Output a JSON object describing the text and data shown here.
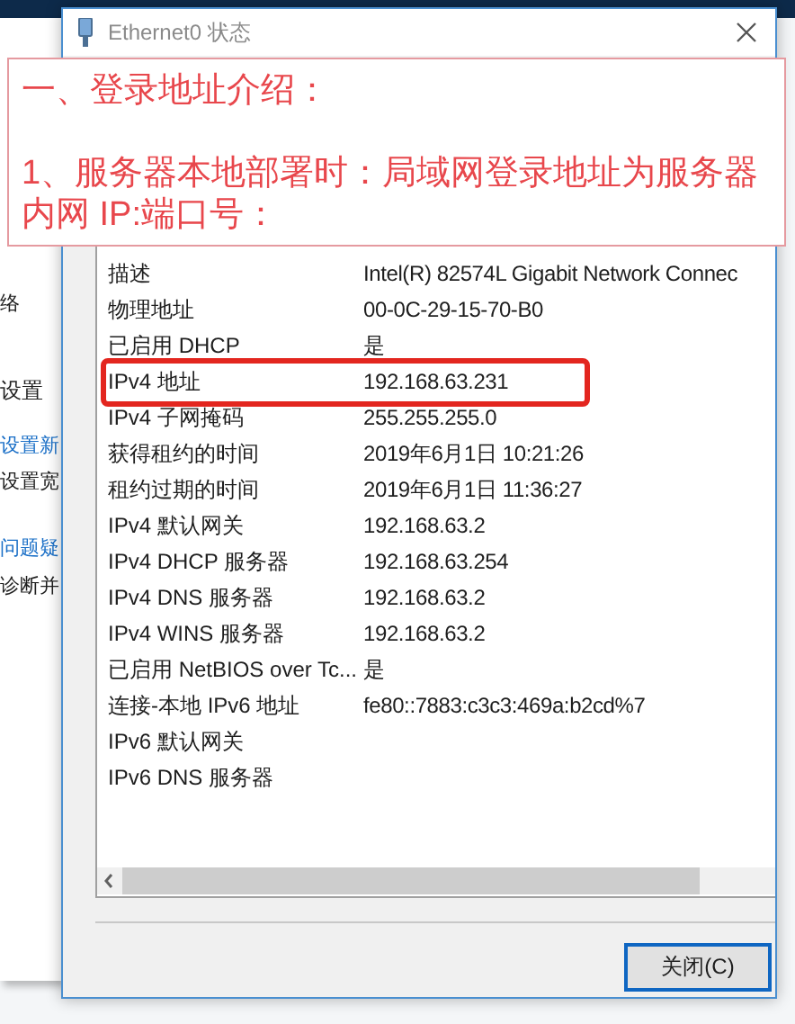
{
  "background_window": {
    "texts": [
      {
        "text": "络",
        "kind": "plain"
      },
      {
        "text": "设置",
        "kind": "heading"
      },
      {
        "text": "设置新",
        "kind": "link"
      },
      {
        "text": "设置宽",
        "kind": "plain"
      },
      {
        "text": "问题疑",
        "kind": "link"
      },
      {
        "text": "诊断并",
        "kind": "plain"
      }
    ]
  },
  "dialog": {
    "title": "Ethernet0 状态",
    "details": [
      {
        "label": "描述",
        "value": "Intel(R) 82574L Gigabit Network Connec",
        "highlighted": false
      },
      {
        "label": "物理地址",
        "value": "00-0C-29-15-70-B0",
        "highlighted": false
      },
      {
        "label": "已启用 DHCP",
        "value": "是",
        "highlighted": false
      },
      {
        "label": "IPv4 地址",
        "value": "192.168.63.231",
        "highlighted": true
      },
      {
        "label": "IPv4 子网掩码",
        "value": "255.255.255.0",
        "highlighted": false
      },
      {
        "label": "获得租约的时间",
        "value": "2019年6月1日 10:21:26",
        "highlighted": false
      },
      {
        "label": "租约过期的时间",
        "value": "2019年6月1日 11:36:27",
        "highlighted": false
      },
      {
        "label": "IPv4 默认网关",
        "value": "192.168.63.2",
        "highlighted": false
      },
      {
        "label": "IPv4 DHCP 服务器",
        "value": "192.168.63.254",
        "highlighted": false
      },
      {
        "label": "IPv4 DNS 服务器",
        "value": "192.168.63.2",
        "highlighted": false
      },
      {
        "label": "IPv4 WINS 服务器",
        "value": "192.168.63.2",
        "highlighted": false
      },
      {
        "label": "已启用 NetBIOS over Tc...",
        "value": "是",
        "highlighted": false
      },
      {
        "label": "连接-本地 IPv6 地址",
        "value": "fe80::7883:c3c3:469a:b2cd%7",
        "highlighted": false
      },
      {
        "label": "IPv6 默认网关",
        "highlighted": false
      },
      {
        "label": "IPv6 DNS 服务器",
        "highlighted": false
      }
    ],
    "close_button": "关闭(C)"
  },
  "annotation": {
    "heading": "一、登录地址介绍：",
    "text": "1、服务器本地部署时：局域网登录地址为服务器内网 IP:端口号："
  }
}
